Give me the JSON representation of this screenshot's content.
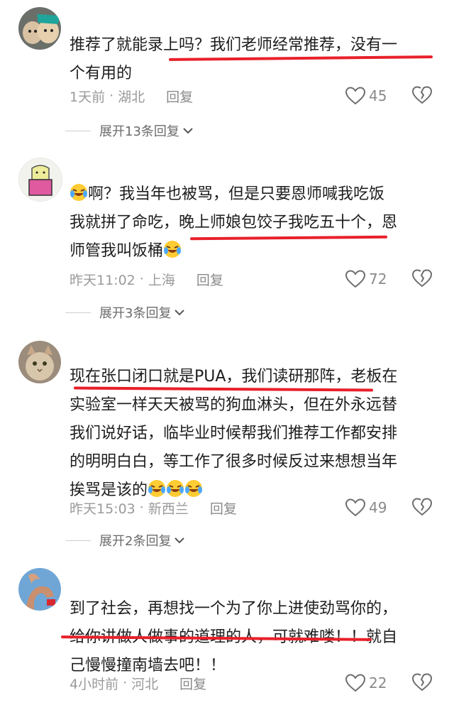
{
  "comments": [
    {
      "text": "推荐了就能录上吗？我们老师经常推荐，没有一个有用的",
      "time": "1天前",
      "location": "湖北",
      "reply_label": "回复",
      "likes": "45",
      "expand_label": "展开13条回复"
    },
    {
      "text_a": "啊？我当年也被骂，但是只要恩师喊我吃饭我就拼了命吃，晚上师娘包饺子我吃五十个，恩师管我叫饭桶",
      "time": "昨天11:02",
      "location": "上海",
      "reply_label": "回复",
      "likes": "72",
      "expand_label": "展开3条回复"
    },
    {
      "text": "现在张口闭口就是PUA，我们读研那阵，老板在实验室一样天天被骂的狗血淋头，但在外永远替我们说好话，临毕业时候帮我们推荐工作都安排的明明白白，等工作了很多时候反过来想想当年挨骂是该的",
      "time": "昨天15:03",
      "location": "新西兰",
      "reply_label": "回复",
      "likes": "49",
      "expand_label": "展开2条回复"
    },
    {
      "text": "到了社会，再想找一个为了你上进使劲骂你的，给你讲做人做事的道理的人，可就难喽！！就自己慢慢撞南墙去吧！！",
      "time": "4小时前",
      "location": "河北",
      "reply_label": "回复",
      "likes": "22"
    }
  ],
  "lines": {
    "c1": [
      "推荐了就能录上吗？我们老师经常推荐，没有一",
      "个有用的"
    ],
    "c2": [
      "啊？我当年也被骂，但是只要恩师喊我吃饭",
      "我就拼了命吃，晚上师娘包饺子我吃五十个，恩",
      "师管我叫饭桶"
    ],
    "c3": [
      "现在张口闭口就是PUA，我们读研那阵，老板在",
      "实验室一样天天被骂的狗血淋头，但在外永远替",
      "我们说好话，临毕业时候帮我们推荐工作都安排",
      "的明明白白，等工作了很多时候反过来想想当年",
      "挨骂是该的"
    ],
    "c4": [
      "到了社会，再想找一个为了你上进使劲骂你的，",
      "给你讲做人做事的道理的人，可就难喽！！就自",
      "己慢慢撞南墙去吧！！"
    ]
  },
  "separator": "·",
  "colors": {
    "underline": "#e8202a",
    "meta": "#9a9a9a"
  }
}
